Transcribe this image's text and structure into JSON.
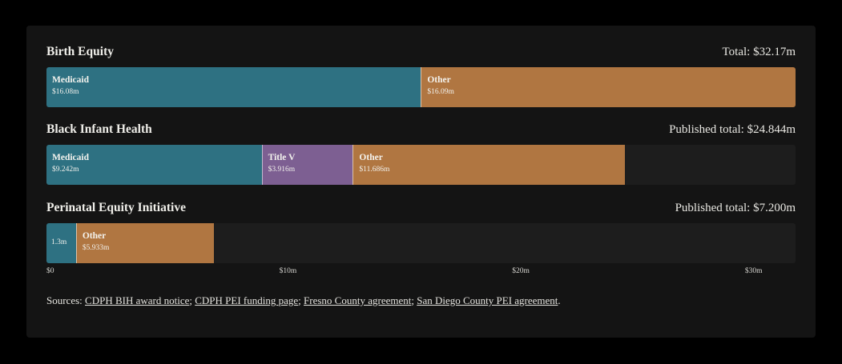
{
  "colors": {
    "medicaid": "#2e7182",
    "title_v": "#7d5f92",
    "other": "#b07641",
    "track": "#1d1d1d",
    "card": "#141414"
  },
  "chart_data": {
    "type": "bar",
    "orientation": "horizontal-stacked",
    "xlim": [
      0,
      32.17
    ],
    "x_ticks": [
      {
        "value": 0,
        "label": "$0"
      },
      {
        "value": 10,
        "label": "$10m"
      },
      {
        "value": 20,
        "label": "$20m"
      },
      {
        "value": 30,
        "label": "$30m"
      }
    ],
    "groups": [
      {
        "title": "Birth Equity",
        "total_label": "Total: $32.17m",
        "segments": [
          {
            "name": "Medicaid",
            "value": 16.08,
            "value_label": "$16.08m",
            "color": "#2e7182"
          },
          {
            "name": "Other",
            "value": 16.09,
            "value_label": "$16.09m",
            "color": "#b07641"
          }
        ]
      },
      {
        "title": "Black Infant Health",
        "total_label": "Published total: $24.844m",
        "segments": [
          {
            "name": "Medicaid",
            "value": 9.242,
            "value_label": "$9.242m",
            "color": "#2e7182"
          },
          {
            "name": "Title V",
            "value": 3.916,
            "value_label": "$3.916m",
            "color": "#7d5f92"
          },
          {
            "name": "Other",
            "value": 11.686,
            "value_label": "$11.686m",
            "color": "#b07641"
          }
        ]
      },
      {
        "title": "Perinatal Equity Initiative",
        "total_label": "Published total: $7.200m",
        "segments": [
          {
            "name": "",
            "value": 1.267,
            "value_label": "1.3m",
            "color": "#2e7182",
            "compact": true
          },
          {
            "name": "Other",
            "value": 5.933,
            "value_label": "$5.933m",
            "color": "#b07641"
          }
        ]
      }
    ]
  },
  "sources": {
    "prefix": "Sources: ",
    "links": [
      "CDPH BIH award notice",
      "CDPH PEI funding page",
      "Fresno County agreement",
      "San Diego County PEI agreement"
    ],
    "separator": "; ",
    "suffix": "."
  }
}
